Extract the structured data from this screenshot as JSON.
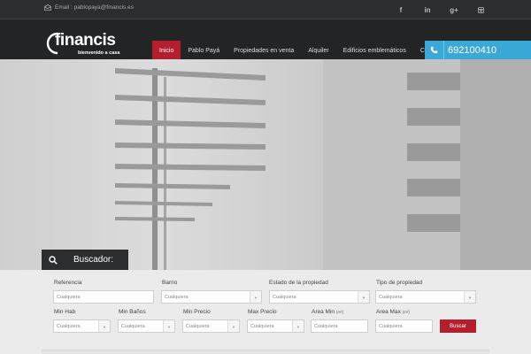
{
  "topbar": {
    "email": "Email : pablopaya@financis.es",
    "social": [
      {
        "icon": "facebook-icon",
        "glyph": "f"
      },
      {
        "icon": "linkedin-icon",
        "glyph": "in"
      },
      {
        "icon": "google-plus-icon",
        "glyph": "g+"
      },
      {
        "icon": "instagram-icon",
        "glyph": ""
      }
    ]
  },
  "brand": {
    "name": "financis",
    "tagline": "bienvenido a casa"
  },
  "nav": {
    "items": [
      "Inicio",
      "Pablo Payá",
      "Propiedades en venta",
      "Alquiler",
      "Edificios emblemáticos",
      "Contacto"
    ],
    "active": "Inicio"
  },
  "phone": {
    "number": "692100410"
  },
  "search": {
    "title": "Buscador:",
    "row1": [
      {
        "label": "Referencia",
        "value": "Cualquiera",
        "type": "text"
      },
      {
        "label": "Barrio",
        "value": "Cualquiera",
        "type": "select"
      },
      {
        "label": "Estado de la propiedad",
        "value": "Cualquiera",
        "type": "select"
      },
      {
        "label": "Tipo de propiedad",
        "value": "Cualquiera",
        "type": "select"
      }
    ],
    "row2": [
      {
        "label": "Min Hab",
        "value": "Cualquiera",
        "type": "select"
      },
      {
        "label": "Min Baños",
        "value": "Cualquiera",
        "type": "select"
      },
      {
        "label": "Min Precio",
        "value": "Cualquiera",
        "type": "select"
      },
      {
        "label": "Max Precio",
        "value": "Cualquiera",
        "type": "select"
      },
      {
        "label": "Area Min",
        "unit": "(m²)",
        "value": "Cualquiera",
        "type": "text"
      },
      {
        "label": "Area Max",
        "unit": "(m²)",
        "value": "Cualquiera",
        "type": "text"
      }
    ],
    "button": "Buscar"
  },
  "colors": {
    "accent": "#b31f2f",
    "phone": "#3aa9d8",
    "dark": "#222426"
  }
}
